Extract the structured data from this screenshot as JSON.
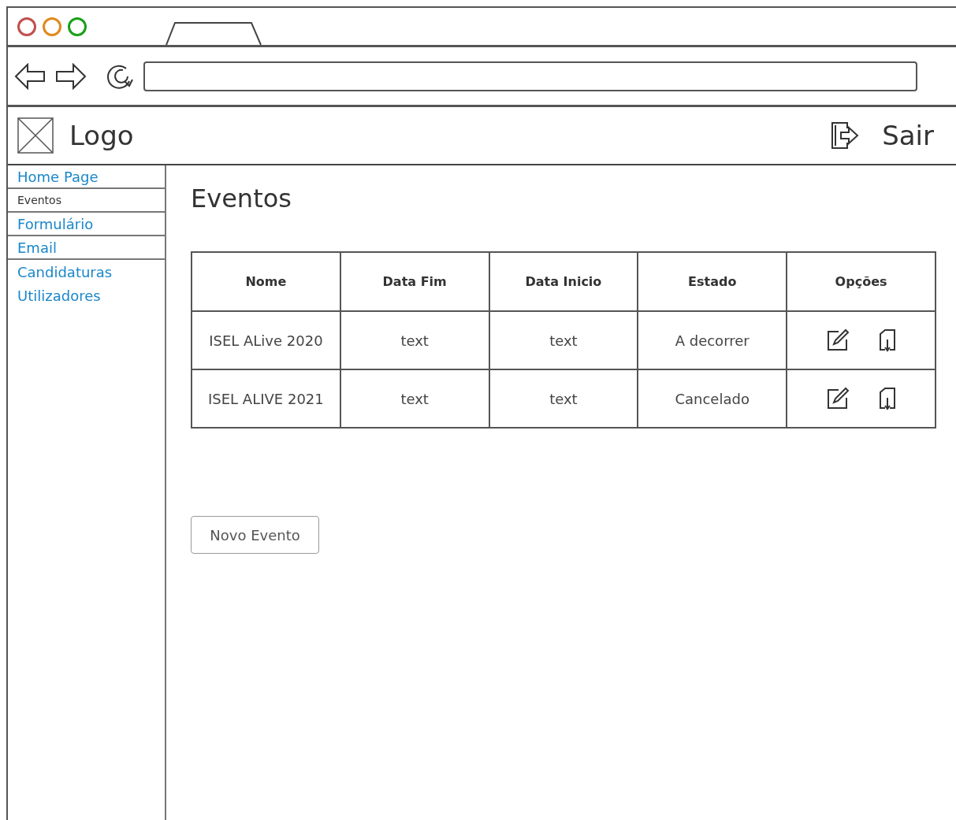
{
  "header": {
    "logo": "Logo",
    "logout": "Sair"
  },
  "sidebar": {
    "items": [
      {
        "label": "Home Page",
        "selected": false
      },
      {
        "label": "Eventos",
        "selected": true
      },
      {
        "label": "Formulário",
        "selected": false
      },
      {
        "label": "Email",
        "selected": false
      },
      {
        "label": "Candidaturas",
        "selected": false
      },
      {
        "label": "Utilizadores",
        "selected": false
      }
    ]
  },
  "page_title": "Eventos",
  "table": {
    "columns": [
      "Nome",
      "Data Fim",
      "Data Inicio",
      "Estado",
      "Opções"
    ],
    "rows": [
      {
        "cells": [
          "ISEL ALive 2020",
          "text",
          "text",
          "A decorrer"
        ]
      },
      {
        "cells": [
          "ISEL ALIVE 2021",
          "text",
          "text",
          "Cancelado"
        ]
      }
    ]
  },
  "new_button": "Novo Evento"
}
